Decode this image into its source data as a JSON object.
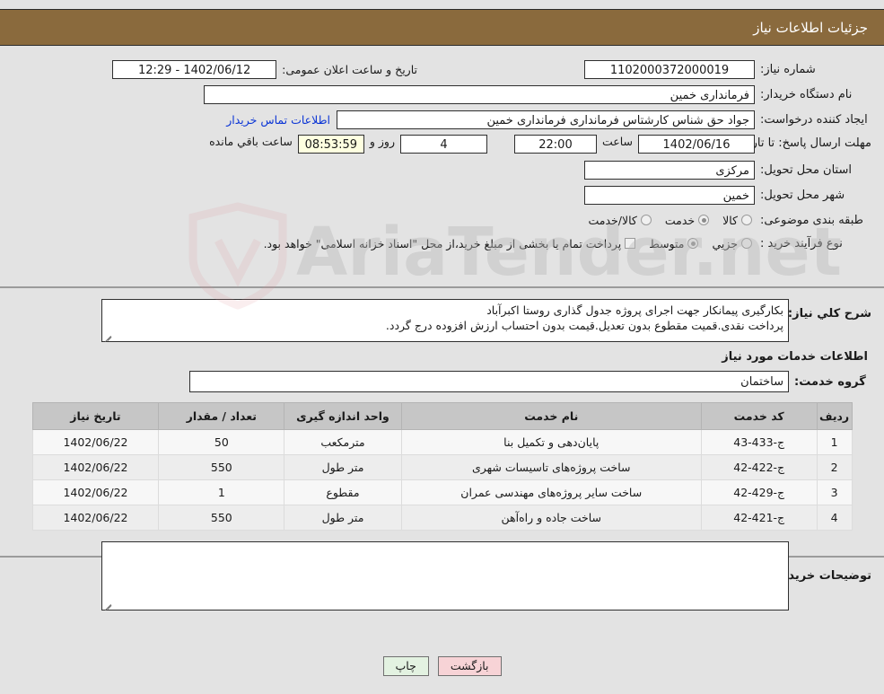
{
  "header": {
    "title": "جزئیات اطلاعات نیاز"
  },
  "info": {
    "need_number_label": "شماره نیاز:",
    "need_number_value": "1102000372000019",
    "public_announce_label": "تاریخ و ساعت اعلان عمومی:",
    "public_announce_value": "12:29 - 1402/06/12",
    "buyer_org_label": "نام دستگاه خریدار:",
    "buyer_org_value": "فرمانداری خمین",
    "creator_label": "ایجاد کننده درخواست:",
    "creator_value": "جواد حق شناس کارشتاس فرمانداری فرمانداری خمین",
    "contact_link": "اطلاعات تماس خریدار",
    "deadline_label": "مهلت ارسال پاسخ: تا تاریخ:",
    "deadline_date": "1402/06/16",
    "hour_label": "ساعت",
    "deadline_time": "22:00",
    "days_value": "4",
    "days_label": "روز و",
    "remaining_time": "08:53:59",
    "remaining_label": "ساعت باقي مانده",
    "province_label": "استان محل تحویل:",
    "province_value": "مرکزی",
    "city_label": "شهر محل تحویل:",
    "city_value": "خمین",
    "category_label": "طبقه بندی موضوعی:",
    "category_options": [
      {
        "label": "کالا",
        "selected": false
      },
      {
        "label": "خدمت",
        "selected": true
      },
      {
        "label": "کالا/خدمت",
        "selected": false
      }
    ],
    "process_label": "نوع فرآیند خرید :",
    "process_options": [
      {
        "label": "جزیي",
        "selected": false
      },
      {
        "label": "متوسط",
        "selected": true
      }
    ],
    "treasury_checkbox_label": "پرداخت تمام یا بخشی از مبلغ خرید،از محل \"اسناد خزانه اسلامی\" خواهد بود.",
    "treasury_checked": false
  },
  "description": {
    "label": "شرح کلي نیاز:",
    "line1": "بکارگیری پیمانکار جهت اجرای پروژه جدول گذاری روستا اکبرآباد",
    "line2": "پرداخت نقدی.قمیت مقطوع بدون تعدیل.قیمت بدون احتساب ارزش افزوده درج گردد."
  },
  "services_section": {
    "title": "اطلاعات خدمات مورد نیاز",
    "group_label": "گروه خدمت:",
    "group_value": "ساختمان"
  },
  "table": {
    "columns": [
      "ردیف",
      "کد خدمت",
      "نام خدمت",
      "واحد اندازه گیری",
      "تعداد / مقدار",
      "تاریخ نیاز"
    ],
    "rows": [
      {
        "radif": "1",
        "code": "ج-433-43",
        "name": "پایان‌دهی و تکمیل بنا",
        "unit": "مترمکعب",
        "qty": "50",
        "date": "1402/06/22"
      },
      {
        "radif": "2",
        "code": "ج-422-42",
        "name": "ساخت پروژه‌های تاسیسات شهری",
        "unit": "متر طول",
        "qty": "550",
        "date": "1402/06/22"
      },
      {
        "radif": "3",
        "code": "ج-429-42",
        "name": "ساخت سایر پروژه‌های مهندسی عمران",
        "unit": "مقطوع",
        "qty": "1",
        "date": "1402/06/22"
      },
      {
        "radif": "4",
        "code": "ج-421-42",
        "name": "ساخت جاده و راه‌آهن",
        "unit": "متر طول",
        "qty": "550",
        "date": "1402/06/22"
      }
    ]
  },
  "buyer_notes": {
    "label": "توضیحات خریدار:",
    "value": ""
  },
  "footer": {
    "back_button": "بازگشت",
    "print_button": "چاپ"
  },
  "watermark": {
    "text": "AriaTender.net"
  },
  "colors": {
    "header_bg": "#8a6a3d",
    "page_bg": "#e3e3e3",
    "link": "#0b35d6",
    "back_button": "#f7d3d6",
    "print_button": "#e3f2e1",
    "table_header": "#c6c6c6",
    "highlight_field": "#feffe0"
  }
}
